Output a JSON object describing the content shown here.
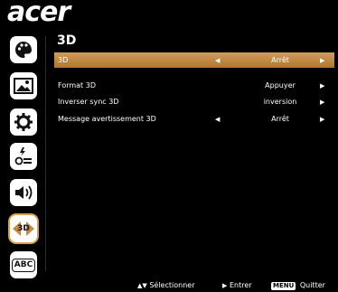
{
  "brand": {
    "logo": "acer"
  },
  "sidebar": {
    "items": [
      {
        "icon": "palette-icon",
        "label": ""
      },
      {
        "icon": "image-icon",
        "label": ""
      },
      {
        "icon": "gear-icon",
        "label": ""
      },
      {
        "icon": "power-icon",
        "label": ""
      },
      {
        "icon": "speaker-icon",
        "label": ""
      },
      {
        "icon": "3d-icon",
        "label": "3D",
        "active": true
      },
      {
        "icon": "language-icon",
        "label": "ABC"
      }
    ]
  },
  "menu": {
    "title": "3D",
    "rows": [
      {
        "label": "3D",
        "value": "Arrêt",
        "left_arrow": true,
        "selected": true
      },
      {
        "label": "Format 3D",
        "value": "Appuyer",
        "left_arrow": false
      },
      {
        "label": "Inverser sync 3D",
        "value": "inversion",
        "left_arrow": false
      },
      {
        "label": "Message avertissement 3D",
        "value": "Arrêt",
        "left_arrow": true
      }
    ]
  },
  "footer": {
    "select": "Sélectionner",
    "enter": "Entrer",
    "menu_key": "MENU",
    "quit": "Quitter"
  },
  "colors": {
    "accent": "#c48a42"
  }
}
